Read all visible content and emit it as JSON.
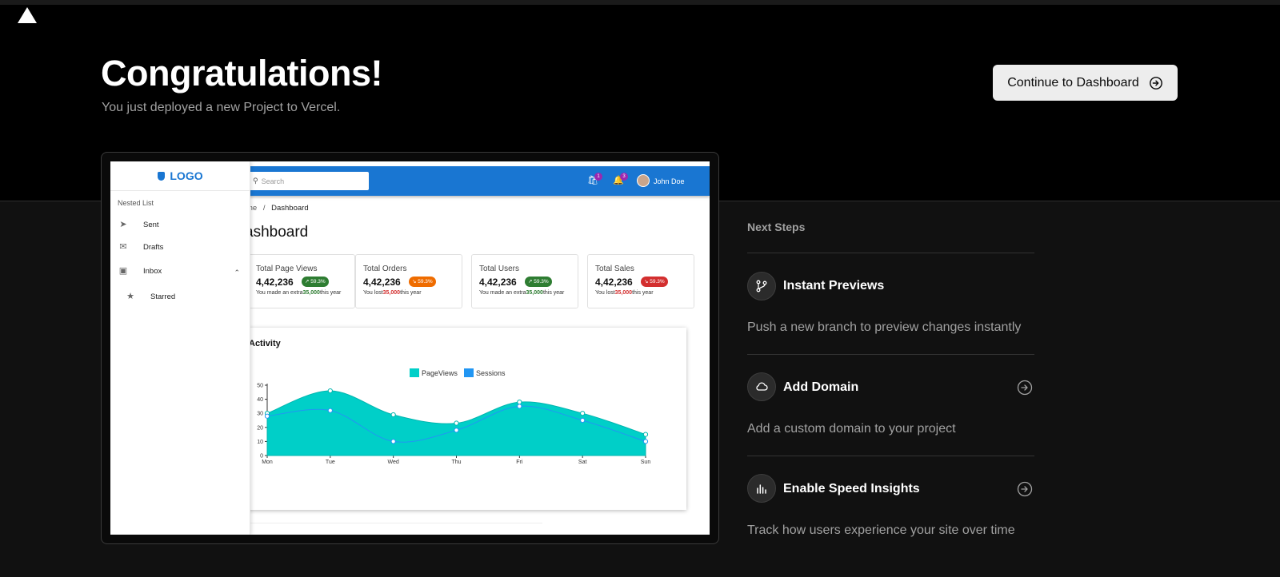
{
  "header": {
    "title": "Congratulations!",
    "subtitle": "You just deployed a new Project to Vercel.",
    "cta_label": "Continue to Dashboard"
  },
  "preview": {
    "sidebar": {
      "logo": "LOGO",
      "section_label": "Nested List",
      "items": [
        {
          "label": "Sent",
          "icon": "send-icon"
        },
        {
          "label": "Drafts",
          "icon": "drafts-icon"
        },
        {
          "label": "Inbox",
          "icon": "inbox-icon"
        },
        {
          "label": "Starred",
          "icon": "star-icon"
        }
      ]
    },
    "topbar": {
      "search_placeholder": "Search",
      "cart_badge": "1",
      "notif_badge": "3",
      "user_name": "John Doe"
    },
    "breadcrumb": {
      "home": "me",
      "sep": "/",
      "current": "Dashboard"
    },
    "page_title": "ashboard",
    "cards": [
      {
        "title": "Total Page Views",
        "value": "4,42,236",
        "pct": "59.3%",
        "trend": "up",
        "color": "#2e7d32",
        "note_pre": "You made an extra",
        "note_amt": "35,000",
        "note_post": "this year"
      },
      {
        "title": "Total Orders",
        "value": "4,42,236",
        "pct": "59.3%",
        "trend": "down",
        "color": "#ef6c00",
        "note_pre": "You lost",
        "note_amt": "35,000",
        "note_post": "this year"
      },
      {
        "title": "Total Users",
        "value": "4,42,236",
        "pct": "59.3%",
        "trend": "up",
        "color": "#2e7d32",
        "note_pre": "You made an extra",
        "note_amt": "35,000",
        "note_post": "this year"
      },
      {
        "title": "Total Sales",
        "value": "4,42,236",
        "pct": "59.3%",
        "trend": "down",
        "color": "#d32f2f",
        "note_pre": "You lost",
        "note_amt": "35,000",
        "note_post": "this year"
      }
    ],
    "activity_title": "Activity",
    "chart_data": {
      "type": "area",
      "categories": [
        "Mon",
        "Tue",
        "Wed",
        "Thu",
        "Fri",
        "Sat",
        "Sun"
      ],
      "series": [
        {
          "name": "PageViews",
          "values": [
            30,
            46,
            29,
            23,
            38,
            30,
            15
          ],
          "color": "#00cfc8"
        },
        {
          "name": "Sessions",
          "values": [
            28,
            32,
            10,
            18,
            35,
            25,
            10
          ],
          "color": "#2196f3"
        }
      ],
      "ylim": [
        0,
        50
      ],
      "yticks": [
        0,
        10,
        20,
        30,
        40,
        50
      ],
      "legend": "top-center"
    }
  },
  "next_steps": {
    "heading": "Next Steps",
    "items": [
      {
        "title": "Instant Previews",
        "desc": "Push a new branch to preview changes instantly",
        "icon": "git-branch-icon"
      },
      {
        "title": "Add Domain",
        "desc": "Add a custom domain to your project",
        "icon": "cloud-icon"
      },
      {
        "title": "Enable Speed Insights",
        "desc": "Track how users experience your site over time",
        "icon": "bar-chart-icon"
      }
    ]
  }
}
